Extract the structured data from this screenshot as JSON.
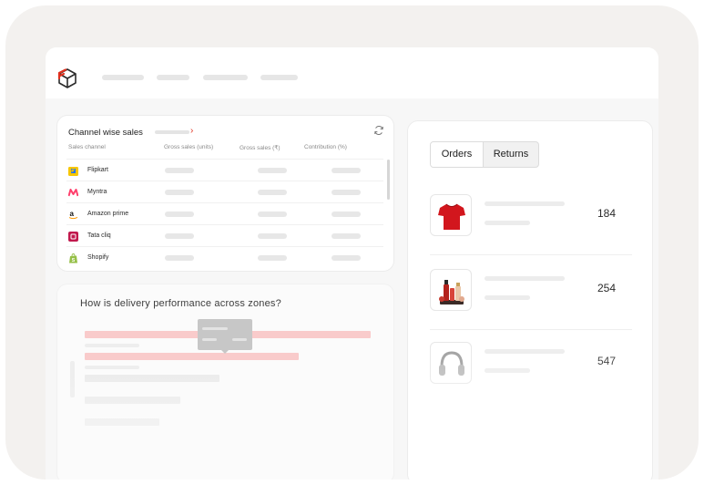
{
  "colors": {
    "brand": "#e0301e",
    "bar_pink": "#f9cbcb",
    "bar_grey": "#ececec",
    "tshirt": "#d2161d"
  },
  "app": {
    "logo_icon": "box-logo-icon"
  },
  "channel_sales": {
    "title": "Channel wise sales",
    "columns": [
      "Sales channel",
      "Gross sales (units)",
      "Gross sales (₹)",
      "Contribution (%)"
    ],
    "rows": [
      {
        "name": "Flipkart",
        "icon": "flipkart-icon"
      },
      {
        "name": "Myntra",
        "icon": "myntra-icon"
      },
      {
        "name": "Amazon prime",
        "icon": "amazon-icon"
      },
      {
        "name": "Tata cliq",
        "icon": "tata-cliq-icon"
      },
      {
        "name": "Shopify",
        "icon": "shopify-icon"
      }
    ]
  },
  "delivery": {
    "title": "How is delivery performance across zones?"
  },
  "orders_panel": {
    "tabs": [
      "Orders",
      "Returns"
    ],
    "selected_tab": "Orders",
    "products": [
      {
        "icon": "tshirt-icon",
        "value": "184"
      },
      {
        "icon": "cosmetics-icon",
        "value": "254"
      },
      {
        "icon": "headphones-icon",
        "value": "547"
      }
    ]
  }
}
